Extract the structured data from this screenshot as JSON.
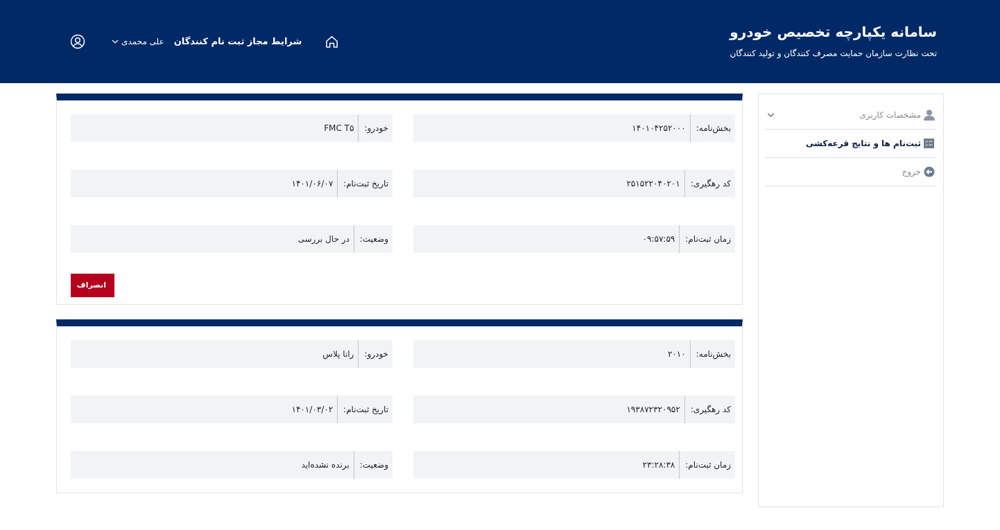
{
  "header": {
    "title": "سامانه یکپارچه تخصیص خودرو",
    "subtitle": "تحت نظارت سازمان حمایت مصرف کنندگان و تولید کنندگان"
  },
  "nav": [
    {
      "kind": "home"
    },
    {
      "kind": "link",
      "label": "شرایط مجاز ثبت نام کنندگان"
    },
    {
      "kind": "user",
      "label": "علی محمدی"
    },
    {
      "kind": "avatar"
    }
  ],
  "sidebar": {
    "items": [
      {
        "kind": "person",
        "label": "مشخصات کاربری",
        "selected": false,
        "expandable": true
      },
      {
        "kind": "list",
        "label": "ثبت‌نام ها و نتایج قرعه‌کشی",
        "selected": true,
        "expandable": false
      },
      {
        "kind": "exit",
        "label": "خروج",
        "selected": false,
        "expandable": false
      }
    ]
  },
  "cards": [
    {
      "fields": [
        {
          "label": "بخش‌نامه:",
          "value": "۱۴۰۱۰۴۲۵۲۰۰۰"
        },
        {
          "label": "خودرو:",
          "value": "FMC T۵"
        },
        {
          "label": "کد رهگیری:",
          "value": "۲۵۱۵۲۲۰۴۰۲۰۱"
        },
        {
          "label": "تاریخ ثبت‌نام:",
          "value": "۱۴۰۱/۰۶/۰۷"
        },
        {
          "label": "زمان ثبت‌نام:",
          "value": "۰۹:۵۷:۵۹"
        },
        {
          "label": "وضعیت:",
          "value": "در حال بررسی"
        }
      ],
      "cancel_button": {
        "label": "انصراف"
      }
    },
    {
      "fields": [
        {
          "label": "بخش‌نامه:",
          "value": "۲۰۱۰"
        },
        {
          "label": "خودرو:",
          "value": "رانا پلاس"
        },
        {
          "label": "کد رهگیری:",
          "value": "۱۹۳۸۷۲۳۲۰۹۵۲"
        },
        {
          "label": "تاریخ ثبت‌نام:",
          "value": "۱۴۰۱/۰۳/۰۲"
        },
        {
          "label": "زمان ثبت‌نام:",
          "value": "۲۳:۲۸:۳۸"
        },
        {
          "label": "وضعیت:",
          "value": "برنده نشده‌اید"
        }
      ]
    }
  ]
}
